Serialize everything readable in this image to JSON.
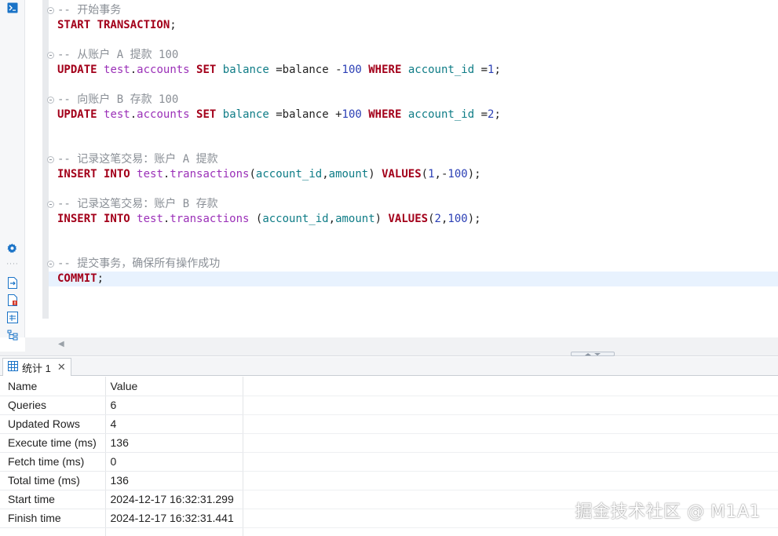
{
  "editor": {
    "lines": [
      [
        {
          "c": "cm",
          "t": "-- "
        },
        {
          "c": "cm zh",
          "t": "开始事务"
        }
      ],
      [
        {
          "c": "kw",
          "t": "START TRANSACTION"
        },
        {
          "c": "pn",
          "t": ";"
        }
      ],
      [],
      [
        {
          "c": "cm",
          "t": "-- "
        },
        {
          "c": "cm zh",
          "t": "从账户"
        },
        {
          "c": "cm",
          "t": " A "
        },
        {
          "c": "cm zh",
          "t": "提款"
        },
        {
          "c": "cm",
          "t": " 100"
        }
      ],
      [
        {
          "c": "kw",
          "t": "UPDATE"
        },
        {
          "c": "pn",
          "t": " "
        },
        {
          "c": "sc",
          "t": "test"
        },
        {
          "c": "pn",
          "t": "."
        },
        {
          "c": "tb",
          "t": "accounts"
        },
        {
          "c": "pn",
          "t": " "
        },
        {
          "c": "kw",
          "t": "SET"
        },
        {
          "c": "pn",
          "t": " "
        },
        {
          "c": "id",
          "t": "balance"
        },
        {
          "c": "op",
          "t": " =balance -"
        },
        {
          "c": "nm",
          "t": "100"
        },
        {
          "c": "pn",
          "t": " "
        },
        {
          "c": "kw",
          "t": "WHERE"
        },
        {
          "c": "pn",
          "t": " "
        },
        {
          "c": "id",
          "t": "account_id"
        },
        {
          "c": "op",
          "t": " ="
        },
        {
          "c": "nm",
          "t": "1"
        },
        {
          "c": "pn",
          "t": ";"
        }
      ],
      [],
      [
        {
          "c": "cm",
          "t": "-- "
        },
        {
          "c": "cm zh",
          "t": "向账户"
        },
        {
          "c": "cm",
          "t": " B "
        },
        {
          "c": "cm zh",
          "t": "存款"
        },
        {
          "c": "cm",
          "t": " 100"
        }
      ],
      [
        {
          "c": "kw",
          "t": "UPDATE"
        },
        {
          "c": "pn",
          "t": " "
        },
        {
          "c": "sc",
          "t": "test"
        },
        {
          "c": "pn",
          "t": "."
        },
        {
          "c": "tb",
          "t": "accounts"
        },
        {
          "c": "pn",
          "t": " "
        },
        {
          "c": "kw",
          "t": "SET"
        },
        {
          "c": "pn",
          "t": " "
        },
        {
          "c": "id",
          "t": "balance"
        },
        {
          "c": "op",
          "t": " =balance +"
        },
        {
          "c": "nm",
          "t": "100"
        },
        {
          "c": "pn",
          "t": " "
        },
        {
          "c": "kw",
          "t": "WHERE"
        },
        {
          "c": "pn",
          "t": " "
        },
        {
          "c": "id",
          "t": "account_id"
        },
        {
          "c": "op",
          "t": " ="
        },
        {
          "c": "nm",
          "t": "2"
        },
        {
          "c": "pn",
          "t": ";"
        }
      ],
      [],
      [],
      [
        {
          "c": "cm",
          "t": "-- "
        },
        {
          "c": "cm zh",
          "t": "记录这笔交易：账户"
        },
        {
          "c": "cm",
          "t": " A "
        },
        {
          "c": "cm zh",
          "t": "提款"
        }
      ],
      [
        {
          "c": "kw",
          "t": "INSERT INTO"
        },
        {
          "c": "pn",
          "t": " "
        },
        {
          "c": "sc",
          "t": "test"
        },
        {
          "c": "pn",
          "t": "."
        },
        {
          "c": "tb",
          "t": "transactions"
        },
        {
          "c": "pn",
          "t": "("
        },
        {
          "c": "id",
          "t": "account_id"
        },
        {
          "c": "pn",
          "t": ","
        },
        {
          "c": "id",
          "t": "amount"
        },
        {
          "c": "pn",
          "t": ") "
        },
        {
          "c": "kw",
          "t": "VALUES"
        },
        {
          "c": "pn",
          "t": "("
        },
        {
          "c": "nm",
          "t": "1"
        },
        {
          "c": "pn",
          "t": ",-"
        },
        {
          "c": "nm",
          "t": "100"
        },
        {
          "c": "pn",
          "t": ");"
        }
      ],
      [],
      [
        {
          "c": "cm",
          "t": "-- "
        },
        {
          "c": "cm zh",
          "t": "记录这笔交易：账户"
        },
        {
          "c": "cm",
          "t": " B "
        },
        {
          "c": "cm zh",
          "t": "存款"
        }
      ],
      [
        {
          "c": "kw",
          "t": "INSERT INTO"
        },
        {
          "c": "pn",
          "t": " "
        },
        {
          "c": "sc",
          "t": "test"
        },
        {
          "c": "pn",
          "t": "."
        },
        {
          "c": "tb",
          "t": "transactions"
        },
        {
          "c": "pn",
          "t": " ("
        },
        {
          "c": "id",
          "t": "account_id"
        },
        {
          "c": "pn",
          "t": ","
        },
        {
          "c": "id",
          "t": "amount"
        },
        {
          "c": "pn",
          "t": ") "
        },
        {
          "c": "kw",
          "t": "VALUES"
        },
        {
          "c": "pn",
          "t": "("
        },
        {
          "c": "nm",
          "t": "2"
        },
        {
          "c": "pn",
          "t": ","
        },
        {
          "c": "nm",
          "t": "100"
        },
        {
          "c": "pn",
          "t": ");"
        }
      ],
      [],
      [],
      [
        {
          "c": "cm",
          "t": "-- "
        },
        {
          "c": "cm zh",
          "t": "提交事务，确保所有操作成功"
        }
      ],
      [
        {
          "c": "kw",
          "t": "COMMIT"
        },
        {
          "c": "pn",
          "t": ";"
        }
      ]
    ],
    "fold_lines": [
      0,
      3,
      6,
      10,
      13,
      17
    ],
    "current_line": 18
  },
  "results": {
    "tab_label": "统计 1",
    "columns": [
      "Name",
      "Value"
    ],
    "rows": [
      [
        "Queries",
        "6"
      ],
      [
        "Updated Rows",
        "4"
      ],
      [
        "Execute time (ms)",
        "136"
      ],
      [
        "Fetch time (ms)",
        "0"
      ],
      [
        "Total time (ms)",
        "136"
      ],
      [
        "Start time",
        "2024-12-17 16:32:31.299"
      ],
      [
        "Finish time",
        "2024-12-17 16:32:31.441"
      ],
      [
        "",
        ""
      ]
    ]
  },
  "watermark": "掘金技术社区 @ M1A1",
  "colors": {
    "keyword": "#a3001a",
    "schema": "#9b30b8",
    "identifier": "#0e7c86",
    "number": "#2b3fb5",
    "comment": "#8a8f96",
    "current_line_bg": "#e8f2fe",
    "tool_icon": "#1a73c7"
  },
  "icons": {
    "tool_terminal": "terminal-icon",
    "tool_settings": "gear-icon",
    "tool_export": "export-icon",
    "tool_file_error": "file-error-icon",
    "tool_file_csv": "file-csv-icon",
    "tool_tree": "tree-structure-icon",
    "tab_grid": "grid-icon",
    "tab_close": "close-icon",
    "scroll_left": "chevron-left-icon"
  }
}
